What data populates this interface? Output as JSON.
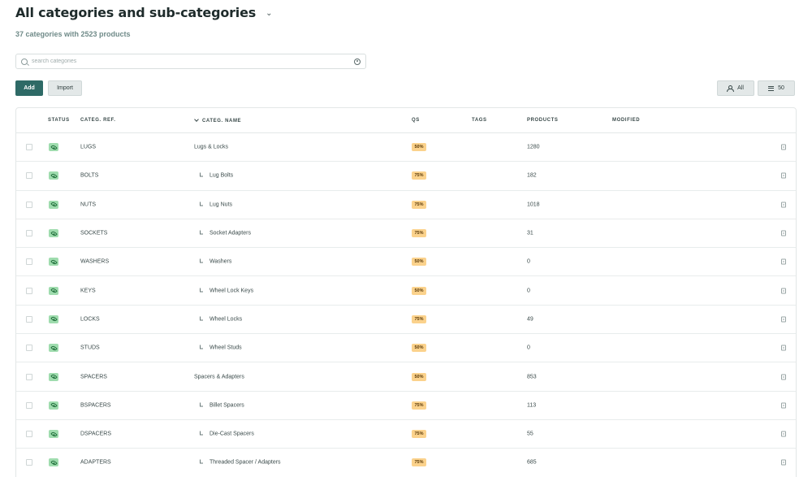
{
  "header": {
    "title": "All categories and sub-categories",
    "subtitle": "37 categories with 2523 products"
  },
  "search": {
    "placeholder": "search categories",
    "value": ""
  },
  "toolbar": {
    "add_label": "Add",
    "import_label": "Import",
    "filter_label": "All",
    "per_page_label": "50"
  },
  "table": {
    "columns": {
      "status": "STATUS",
      "ref": "CATEG. REF.",
      "name": "CATEG. NAME",
      "qs": "QS",
      "tags": "TAGS",
      "products": "PRODUCTS",
      "modified": "MODIFIED"
    },
    "sorted_column": "name",
    "rows": [
      {
        "ref": "LUGS",
        "name": "Lugs & Locks",
        "child": false,
        "qs": "50%",
        "products": "1280"
      },
      {
        "ref": "BOLTS",
        "name": "Lug Bolts",
        "child": true,
        "qs": "75%",
        "products": "182"
      },
      {
        "ref": "NUTS",
        "name": "Lug Nuts",
        "child": true,
        "qs": "75%",
        "products": "1018"
      },
      {
        "ref": "SOCKETS",
        "name": "Socket Adapters",
        "child": true,
        "qs": "75%",
        "products": "31"
      },
      {
        "ref": "WASHERS",
        "name": "Washers",
        "child": true,
        "qs": "50%",
        "products": "0"
      },
      {
        "ref": "KEYS",
        "name": "Wheel Lock Keys",
        "child": true,
        "qs": "50%",
        "products": "0"
      },
      {
        "ref": "LOCKS",
        "name": "Wheel Locks",
        "child": true,
        "qs": "75%",
        "products": "49"
      },
      {
        "ref": "STUDS",
        "name": "Wheel Studs",
        "child": true,
        "qs": "50%",
        "products": "0"
      },
      {
        "ref": "SPACERS",
        "name": "Spacers & Adapters",
        "child": false,
        "qs": "50%",
        "products": "853"
      },
      {
        "ref": "BSPACERS",
        "name": "Billet Spacers",
        "child": true,
        "qs": "75%",
        "products": "113"
      },
      {
        "ref": "DSPACERS",
        "name": "Die-Cast Spacers",
        "child": true,
        "qs": "75%",
        "products": "55"
      },
      {
        "ref": "ADAPTERS",
        "name": "Threaded Spacer / Adapters",
        "child": true,
        "qs": "75%",
        "products": "685"
      }
    ]
  },
  "colors": {
    "primary": "#2e6a66",
    "status_green": "#9fdcae",
    "qs_orange": "#fbd28c"
  },
  "icons": {
    "title": "chevron-down-icon",
    "search": "search-icon",
    "settings": "settings-icon",
    "filter": "user-icon",
    "per_page": "list-icon",
    "status": "eye-icon",
    "child": "child-indent-icon",
    "row_action": "document-icon"
  }
}
